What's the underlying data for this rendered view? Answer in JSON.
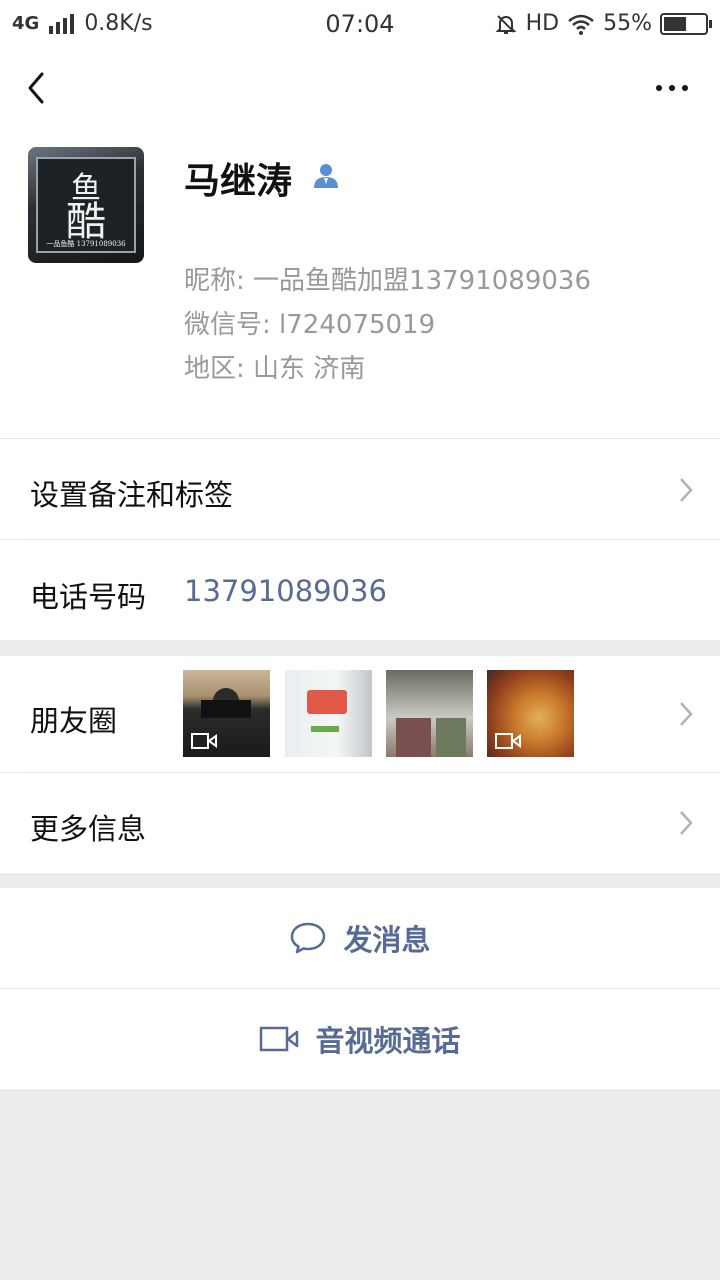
{
  "status_bar": {
    "network": "4G",
    "speed": "0.8K/s",
    "time": "07:04",
    "hd": "HD",
    "battery": "55%",
    "battery_level": 0.55
  },
  "header": {
    "back_icon": "chevron-left-icon",
    "more_icon": "more-dots-icon"
  },
  "profile": {
    "avatar_text_top": "鱼",
    "avatar_text_main": "酷",
    "avatar_caption": "一品鱼酷 13791089036",
    "name": "马继涛",
    "contact_icon": "contact-person-icon",
    "nickname": "昵称:  一品鱼酷加盟13791089036",
    "wechat_id": "微信号:  l724075019",
    "region": "地区:  山东  济南"
  },
  "rows": {
    "remark_label": "设置备注和标签",
    "phone_label": "电话号码",
    "phone_value": "13791089036",
    "moments_label": "朋友圈",
    "more_info_label": "更多信息"
  },
  "actions": {
    "message_label": "发消息",
    "message_icon": "chat-bubble-icon",
    "call_label": "音视频通话",
    "call_icon": "video-camera-icon"
  },
  "colors": {
    "link_blue": "#576b95",
    "secondary_text": "#999999",
    "background": "#ededed"
  }
}
